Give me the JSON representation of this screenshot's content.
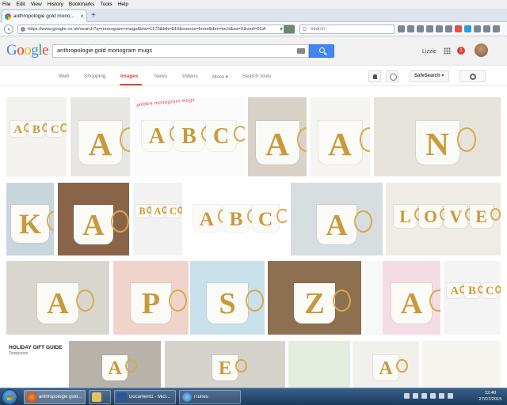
{
  "menu": [
    "File",
    "Edit",
    "View",
    "History",
    "Bookmarks",
    "Tools",
    "Help"
  ],
  "tab": {
    "title": "anthropologie gold mono...",
    "close": "×"
  },
  "newtab": "+",
  "nav": {
    "url": "https://www.google.co.uk/search?q=monogram+mugs&biw=1173&bih=816&source=lnms&tbm=isch&sa=X&ved=0CA",
    "search_placeholder": "Search",
    "back": "‹",
    "reload": "C"
  },
  "google": {
    "logo_letters": [
      "G",
      "o",
      "o",
      "g",
      "l",
      "e"
    ],
    "logo_colors": [
      "#4285f4",
      "#ea4335",
      "#fbbc05",
      "#4285f4",
      "#34a853",
      "#ea4335"
    ],
    "query": "anthropologie gold monogram mugs",
    "user": "Lizzie",
    "notifications": "1"
  },
  "search_tabs": [
    {
      "label": "Web",
      "active": false
    },
    {
      "label": "Shopping",
      "active": false
    },
    {
      "label": "Images",
      "active": true
    },
    {
      "label": "News",
      "active": false
    },
    {
      "label": "Videos",
      "active": false
    },
    {
      "label": "More ▾",
      "active": false
    },
    {
      "label": "Search tools",
      "active": false
    }
  ],
  "safesearch": "SafeSearch ▾",
  "images": {
    "banner_text": "golden monogram mugs",
    "gift_title": "HOLIDAY GIFT GUIDE",
    "gift_sub": "Teaspoons"
  },
  "taskbar": {
    "tasks": [
      {
        "label": "anthropologie gold..."
      },
      {
        "label": ""
      },
      {
        "label": "Document1 - Micr..."
      },
      {
        "label": "iTunes"
      }
    ],
    "time": "12:40",
    "date": "27/07/2015"
  }
}
